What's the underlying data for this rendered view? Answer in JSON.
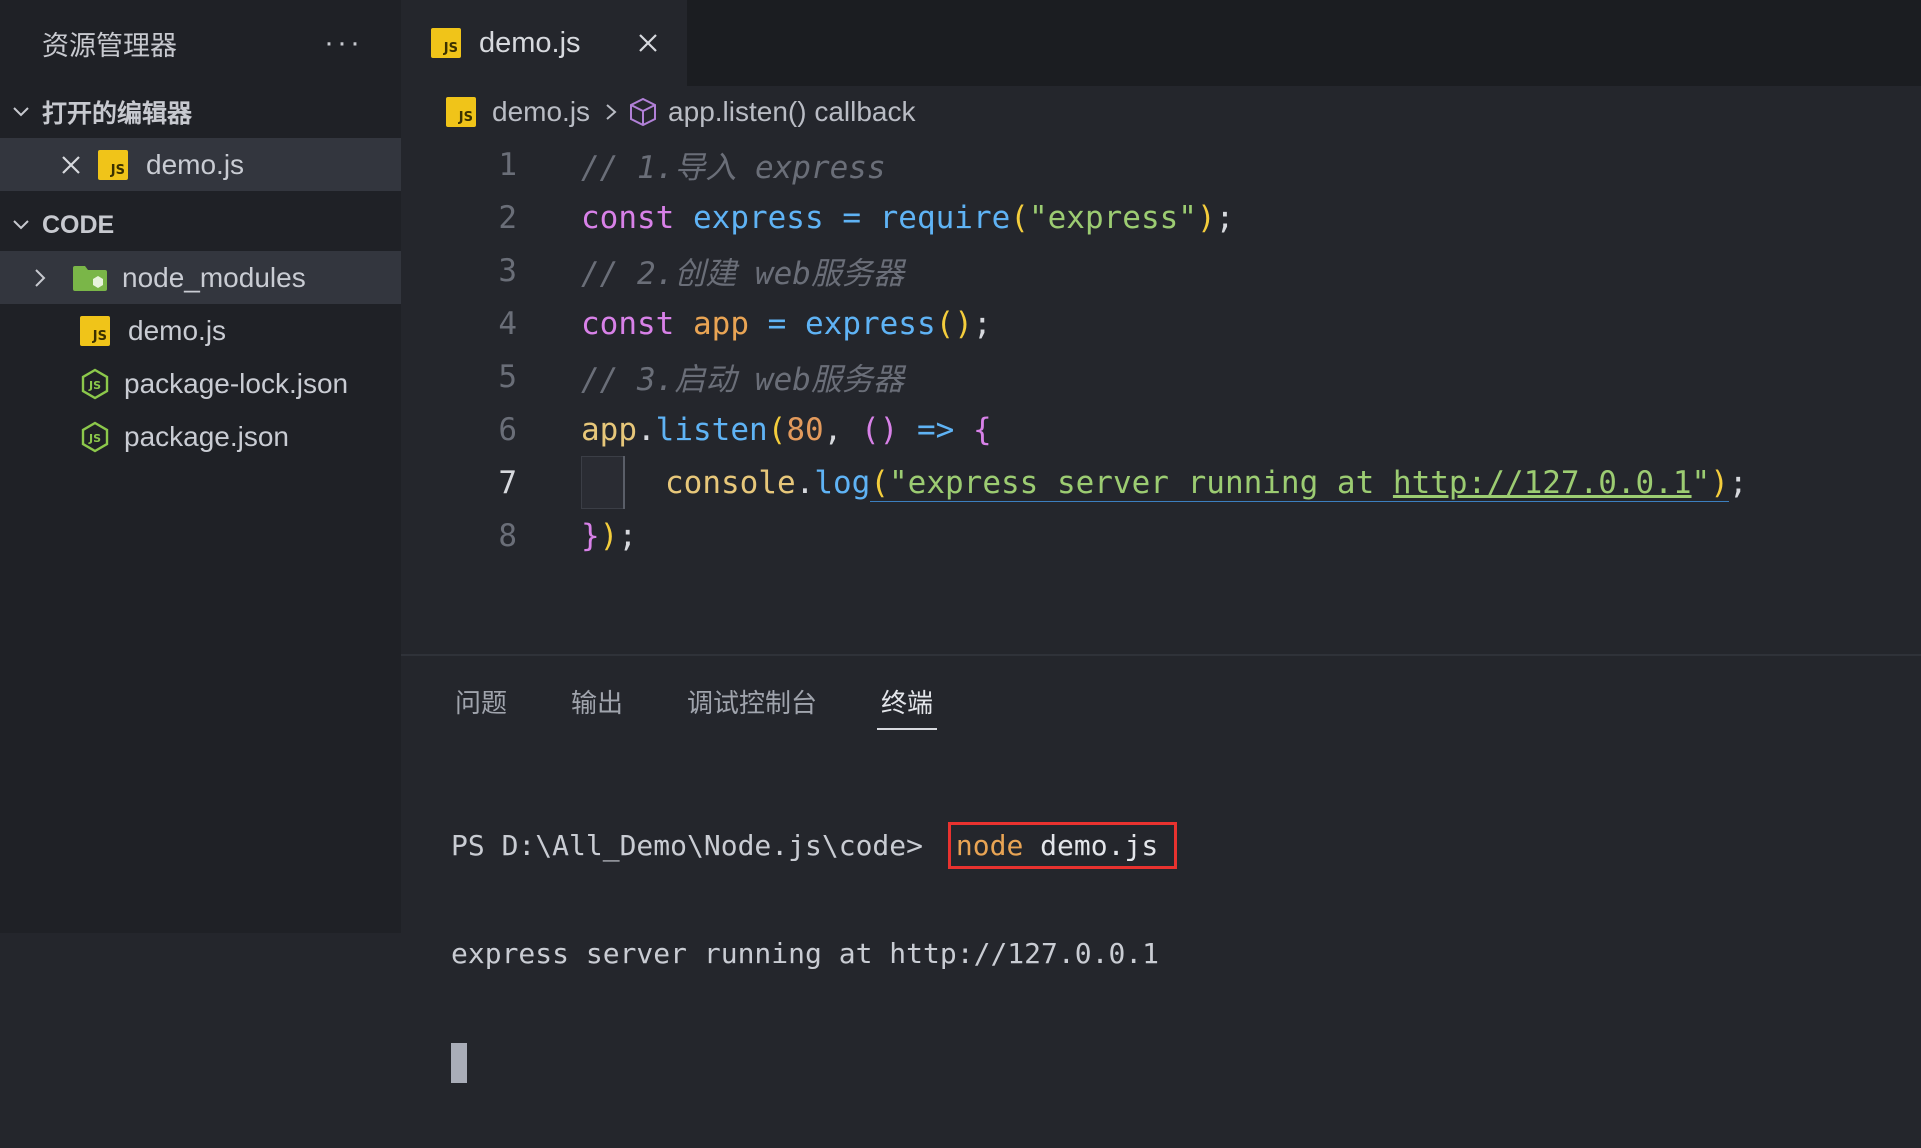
{
  "sidebar": {
    "title": "资源管理器",
    "more_label": "···",
    "open_editors": {
      "label": "打开的编辑器",
      "items": [
        {
          "name": "demo.js"
        }
      ]
    },
    "workspace": {
      "label": "CODE",
      "items": [
        {
          "name": "node_modules",
          "type": "folder"
        },
        {
          "name": "demo.js",
          "type": "js"
        },
        {
          "name": "package-lock.json",
          "type": "json"
        },
        {
          "name": "package.json",
          "type": "json"
        }
      ]
    }
  },
  "tab": {
    "label": "demo.js",
    "icon": "js-file-icon"
  },
  "breadcrumb": {
    "file": "demo.js",
    "symbol": "app.listen() callback"
  },
  "editor": {
    "current_line": 7,
    "lines": [
      {
        "n": "1",
        "t1": "// 1.导入 express"
      },
      {
        "n": "2",
        "t1": "const",
        "t2": " express ",
        "t3": "=",
        "t4": " require",
        "t5": "(",
        "t6": "\"express\"",
        "t7": ")",
        "t8": ";"
      },
      {
        "n": "3",
        "t1": "// 2.创建 web服务器"
      },
      {
        "n": "4",
        "t1": "const",
        "t2": " app ",
        "t3": "=",
        "t4": " express",
        "t5": "()",
        "t6": ";"
      },
      {
        "n": "5",
        "t1": "// 3.启动 web服务器"
      },
      {
        "n": "6",
        "t1": "app",
        "t2": ".",
        "t3": "listen",
        "t4": "(",
        "t5": "80",
        "t6": ", ",
        "t7": "()",
        "t8": " => ",
        "t9": "{"
      },
      {
        "n": "7",
        "t1": "console",
        "t2": ".",
        "t3": "log",
        "t4": "(",
        "t5": "\"express server running at ",
        "t6": "http://127.0.0.1",
        "t7": "\"",
        "t8": ")",
        "t9": ";"
      },
      {
        "n": "8",
        "t1": "}",
        "t2": ")",
        "t3": ";"
      }
    ]
  },
  "panel": {
    "tabs": [
      "问题",
      "输出",
      "调试控制台",
      "终端"
    ],
    "active_tab": "终端"
  },
  "terminal": {
    "prompt": "PS D:\\All_Demo\\Node.js\\code> ",
    "command": "node",
    "argument": " demo.js",
    "output": "express server running at http://127.0.0.1"
  },
  "colors": {
    "highlight_box": "#e8322f",
    "js_badge": "#f0c419",
    "folder_icon": "#7ab648"
  }
}
